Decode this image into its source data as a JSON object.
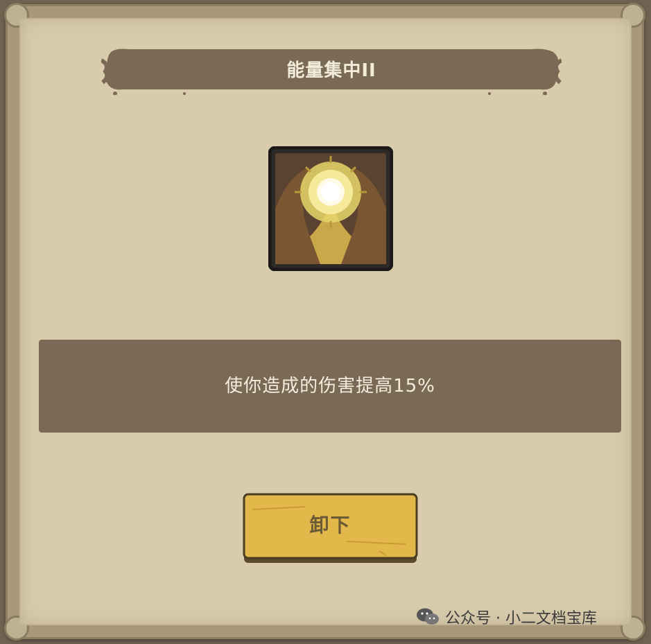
{
  "skill": {
    "title": "能量集中II",
    "icon": "sun-between-hands-icon",
    "description": "使你造成的伤害提高15%"
  },
  "actions": {
    "unequip_label": "卸下"
  },
  "watermark": {
    "icon": "wechat-icon",
    "text": "公众号 · 小二文档宝库"
  },
  "colors": {
    "parchment": "#d8ccad",
    "frame": "#a8997a",
    "banner": "#7a6a55",
    "button": "#e3b84a",
    "text_light": "#f3ecd9"
  }
}
